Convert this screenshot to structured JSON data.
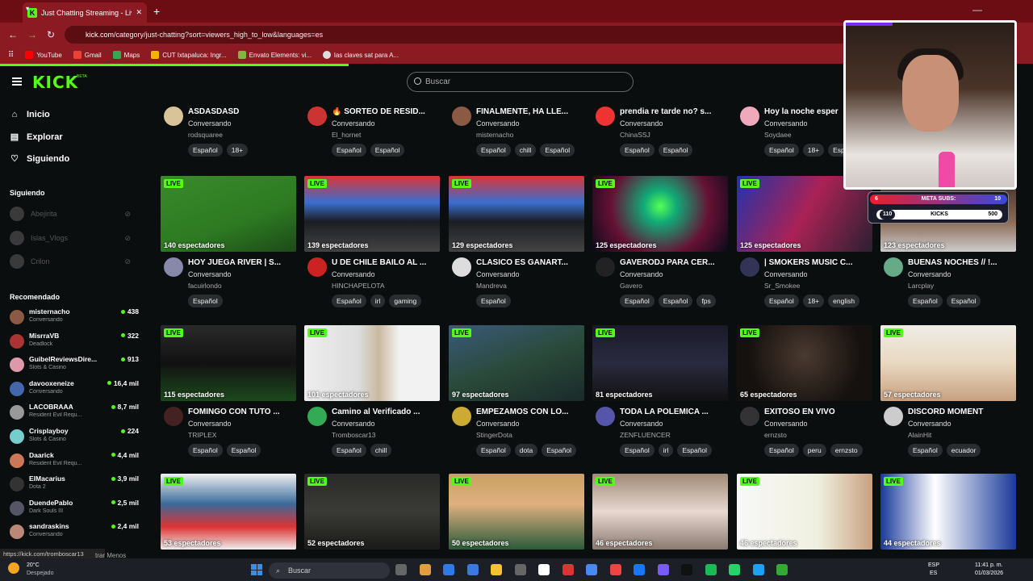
{
  "browser": {
    "tab_title": "Just Chatting Streaming - Live S",
    "url_host": "kick.com",
    "url_path": "/category/just-chatting?sort=viewers_high_to_low&languages=es",
    "bookmarks": [
      {
        "label": "YouTube",
        "color": "#ff0000"
      },
      {
        "label": "Gmail",
        "color": "#ea4335"
      },
      {
        "label": "Maps",
        "color": "#34a853"
      },
      {
        "label": "CUT Ixtapaluca: Ingr...",
        "color": "#f4b400"
      },
      {
        "label": "Envato Elements: vi...",
        "color": "#82b541"
      },
      {
        "label": "las claves sat para A...",
        "color": "#dddddd"
      }
    ]
  },
  "header": {
    "logo": "KICK",
    "beta": "BETA",
    "search_placeholder": "Buscar"
  },
  "sidebar": {
    "nav": [
      {
        "label": "Inicio",
        "icon": "home-icon",
        "glyph": "⌂"
      },
      {
        "label": "Explorar",
        "icon": "explore-icon",
        "glyph": "▤"
      },
      {
        "label": "Siguiendo",
        "icon": "heart-icon",
        "glyph": "♡"
      }
    ],
    "following_title": "Siguiendo",
    "following": [
      "Abejirita",
      "Islas_Vlogs",
      "Crilon"
    ],
    "recommended_title": "Recomendado",
    "recommended": [
      {
        "name": "misternacho",
        "category": "Conversando",
        "viewers": "438",
        "color": "#8a5a44"
      },
      {
        "name": "MisrraVB",
        "category": "Deadlock",
        "viewers": "322",
        "color": "#a33"
      },
      {
        "name": "GuibelReviewsDire...",
        "category": "Slots & Casino",
        "viewers": "913",
        "color": "#d9a"
      },
      {
        "name": "davooxeneize",
        "category": "Conversando",
        "viewers": "16,4 mil",
        "color": "#4466aa"
      },
      {
        "name": "LACOBRAAA",
        "category": "Resident Evil Requ...",
        "viewers": "8,7 mil",
        "color": "#999"
      },
      {
        "name": "Crisplayboy",
        "category": "Slots & Casino",
        "viewers": "224",
        "color": "#7cc"
      },
      {
        "name": "Daarick",
        "category": "Resident Evil Requ...",
        "viewers": "4,4 mil",
        "color": "#c75"
      },
      {
        "name": "ElMacarius",
        "category": "Dota 2",
        "viewers": "3,9 mil",
        "color": "#333"
      },
      {
        "name": "DuendePablo",
        "category": "Dark Souls III",
        "viewers": "2,5 mil",
        "color": "#556"
      },
      {
        "name": "sandraskins",
        "category": "Conversando",
        "viewers": "2,4 mil",
        "color": "#b87"
      }
    ]
  },
  "status_url": "https://kick.com/tromboscar13",
  "status_suffix": "trar Menos",
  "live_label": "LIVE",
  "row0": [
    {
      "title": "ASDASDASD",
      "category": "Conversando",
      "user": "rodsquaree",
      "tags": [
        "Español",
        "18+"
      ],
      "avatar": "#d9c49a"
    },
    {
      "title": "🔥 SORTEO DE RESID...",
      "category": "Conversando",
      "user": "El_hornet",
      "tags": [
        "Español",
        "Español"
      ],
      "avatar": "#c33"
    },
    {
      "title": "FINALMENTE, HA LLE...",
      "category": "Conversando",
      "user": "misternacho",
      "tags": [
        "Español",
        "chill",
        "Español"
      ],
      "avatar": "#8a5a44"
    },
    {
      "title": "prendia re tarde no? s...",
      "category": "Conversando",
      "user": "ChinaSSJ",
      "tags": [
        "Español",
        "Español"
      ],
      "avatar": "#e33"
    },
    {
      "title": "Hoy la noche esper",
      "category": "Conversando",
      "user": "Soydaee",
      "tags": [
        "Español",
        "18+",
        "Esp"
      ],
      "avatar": "#eab"
    }
  ],
  "cards": [
    {
      "viewers": "140 espectadores",
      "title": "HOY JUEGA RIVER | S...",
      "category": "Conversando",
      "user": "facuirlondo",
      "tags": [
        "Español"
      ],
      "thumb": "linear-gradient(160deg,#3a8a2a,#2d7a22 60%,#1d4a18)",
      "avatar": "#88a"
    },
    {
      "viewers": "139 espectadores",
      "title": "U DE CHILE BAILO AL ...",
      "category": "Conversando",
      "user": "HINCHAPELOTA",
      "tags": [
        "Español",
        "irl",
        "gaming"
      ],
      "thumb": "linear-gradient(180deg,#d33 0,#3a6fd0 35%,#1b1d22 60%,#444 100%)",
      "avatar": "#c22"
    },
    {
      "viewers": "129 espectadores",
      "title": "CLASICO ES GANART...",
      "category": "Conversando",
      "user": "Mandreva",
      "tags": [
        "Español"
      ],
      "thumb": "linear-gradient(180deg,#d33 0,#3a6fd0 35%,#1b1d22 60%,#444 100%)",
      "avatar": "#ddd"
    },
    {
      "viewers": "125 espectadores",
      "title": "GAVERODJ PARA CER...",
      "category": "Conversando",
      "user": "Gavero",
      "tags": [
        "Español",
        "Español",
        "fps"
      ],
      "thumb": "radial-gradient(circle at 50% 40%,#5f5 0,#1a7 20%,#613 60%,#0a0a1a)",
      "avatar": "#222"
    },
    {
      "viewers": "125 espectadores",
      "title": "| SMOKERS MUSIC C...",
      "category": "Conversando",
      "user": "Sr_Smokee",
      "tags": [
        "Español",
        "18+",
        "english"
      ],
      "thumb": "linear-gradient(120deg,#2233aa,#aa2255 50%,#2a2030)",
      "avatar": "#335"
    },
    {
      "viewers": "123 espectadores",
      "title": "BUENAS NOCHES // !...",
      "category": "Conversando",
      "user": "Larcplay",
      "tags": [
        "Español",
        "Español"
      ],
      "thumb": "linear-gradient(180deg,#3a2a28,#8a6a55 60%,#ccc)",
      "avatar": "#6a8"
    },
    {
      "viewers": "115 espectadores",
      "title": "FOMINGO CON TUTO ...",
      "category": "Conversando",
      "user": "TRIPLEX",
      "tags": [
        "Español",
        "Español"
      ],
      "thumb": "linear-gradient(180deg,#2a2a2a,#111 50%,#1d4a1d)",
      "avatar": "#422"
    },
    {
      "viewers": "101 espectadores",
      "title": "Camino al Verificado ...",
      "category": "Conversando",
      "user": "Tromboscar13",
      "tags": [
        "Español",
        "chill"
      ],
      "thumb": "linear-gradient(90deg,#eee 0,#ddd 40%,#c9b9a0 55%,#f2f2f2 70%)",
      "avatar": "#3a5"
    },
    {
      "viewers": "97 espectadores",
      "title": "EMPEZAMOS CON LO...",
      "category": "Conversando",
      "user": "StingerDota",
      "tags": [
        "Español",
        "dota",
        "Español"
      ],
      "thumb": "linear-gradient(160deg,#3a5a7a,#2a4a3a 50%,#1a2a2a)",
      "avatar": "#ca3"
    },
    {
      "viewers": "81 espectadores",
      "title": "TODA LA POLEMICA ...",
      "category": "Conversando",
      "user": "ZENFLUENCER",
      "tags": [
        "Español",
        "irl",
        "Español"
      ],
      "thumb": "linear-gradient(180deg,#1a1a2a,#2a2a40 50%,#111)",
      "avatar": "#55a"
    },
    {
      "viewers": "65 espectadores",
      "title": "EXITOSO EN VIVO",
      "category": "Conversando",
      "user": "ernzsto",
      "tags": [
        "Español",
        "peru",
        "ernzsto"
      ],
      "thumb": "radial-gradient(circle at 50% 40%,#4a3a30,#15110f 70%)",
      "avatar": "#333"
    },
    {
      "viewers": "57 espectadores",
      "title": "DISCORD MOMENT",
      "category": "Conversando",
      "user": "AlainHit",
      "tags": [
        "Español",
        "ecuador"
      ],
      "thumb": "linear-gradient(180deg,#f0ede6,#e8d8c0 50%,#c8a080)",
      "avatar": "#ccc"
    },
    {
      "viewers": "53 espectadores",
      "title": "",
      "category": "",
      "user": "",
      "tags": [],
      "thumb": "linear-gradient(180deg,#f0f0f0,#3a6a9a 40%,#d33 70%,#eee)",
      "avatar": "#888"
    },
    {
      "viewers": "52 espectadores",
      "title": "",
      "category": "",
      "user": "",
      "tags": [],
      "thumb": "linear-gradient(180deg,#2a2a28,#3a3a36 50%,#1a1a18)",
      "avatar": "#888"
    },
    {
      "viewers": "50 espectadores",
      "title": "",
      "category": "",
      "user": "",
      "tags": [],
      "thumb": "linear-gradient(180deg,#c8a060,#e0b080 40%,#2a5a3a)",
      "avatar": "#888"
    },
    {
      "viewers": "46 espectadores",
      "title": "",
      "category": "",
      "user": "",
      "tags": [],
      "thumb": "linear-gradient(180deg,#a08a78,#e8d8d0 50%,#8a7a70)",
      "avatar": "#888"
    },
    {
      "viewers": "46 espectadores",
      "title": "",
      "category": "",
      "user": "",
      "tags": [],
      "thumb": "linear-gradient(90deg,#f8f8f8,#f0f0e0 60%,#c8a080)",
      "avatar": "#888"
    },
    {
      "viewers": "44 espectadores",
      "title": "",
      "category": "",
      "user": "",
      "tags": [],
      "thumb": "linear-gradient(90deg,#1a3a9a,#fff 40%,#1a3a9a)",
      "avatar": "#888"
    }
  ],
  "overlay": {
    "meta_label": "META SUBS:",
    "meta_current": "6",
    "meta_goal": "10",
    "kicks_label": "KICKS",
    "kicks_current": "110",
    "kicks_goal": "500"
  },
  "taskbar": {
    "weather_temp": "20°C",
    "weather_desc": "Despejado",
    "search": "Buscar",
    "lang": "ESP",
    "lang2": "ES",
    "time": "11:41 p. m.",
    "date": "01/03/2026"
  }
}
